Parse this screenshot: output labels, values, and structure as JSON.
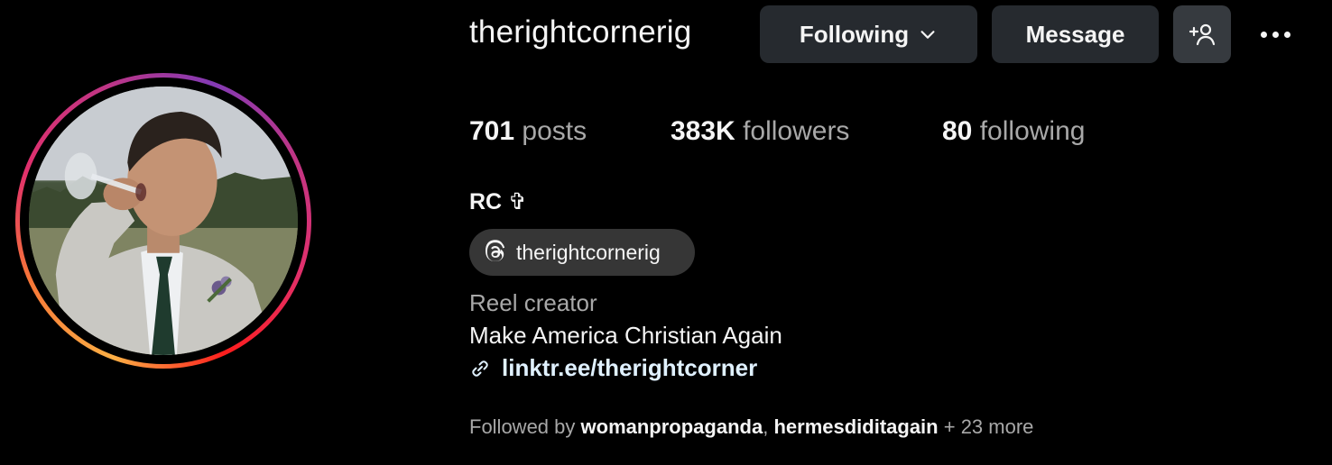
{
  "profile": {
    "username": "therightcornerig",
    "full_name": "RC ✞",
    "category": "Reel creator",
    "bio": "Make America Christian Again",
    "link": "linktr.ee/therightcorner",
    "threads_handle": "therightcornerig"
  },
  "actions": {
    "following_label": "Following",
    "message_label": "Message"
  },
  "stats": {
    "posts_count": "701",
    "posts_label": "posts",
    "followers_count": "383K",
    "followers_label": "followers",
    "following_count": "80",
    "following_label": "following"
  },
  "followed_by": {
    "prefix": "Followed by",
    "accounts": [
      "womanpropaganda",
      "hermesdiditagain"
    ],
    "separator": ",",
    "more": "+ 23 more"
  },
  "icons": {
    "following_chevron": "chevron-down-icon",
    "add_user": "add-user-icon",
    "more": "more-options-icon",
    "threads": "threads-icon",
    "link": "link-icon"
  },
  "colors": {
    "background": "#000000",
    "button_bg": "#262a2f",
    "muted_text": "#a8a8a8",
    "link_text": "#e0f1ff",
    "story_ring": [
      "#fcaf45",
      "#e1306c",
      "#833ab4"
    ]
  }
}
